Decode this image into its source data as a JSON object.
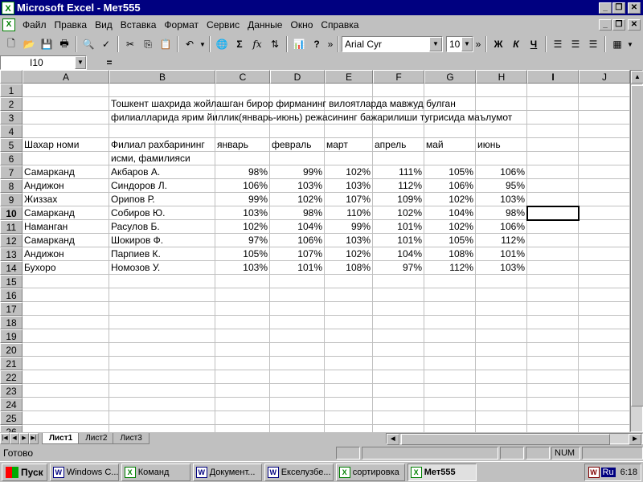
{
  "window": {
    "title": "Microsoft Excel - Мет555"
  },
  "menu": [
    "Файл",
    "Правка",
    "Вид",
    "Вставка",
    "Формат",
    "Сервис",
    "Данные",
    "Окно",
    "Справка"
  ],
  "toolbar": {
    "font_name": "Arial Cyr",
    "font_size": "10"
  },
  "formula_bar": {
    "name_box": "I10",
    "equals": "=",
    "formula": ""
  },
  "columns": [
    "A",
    "B",
    "C",
    "D",
    "E",
    "F",
    "G",
    "H",
    "I",
    "J"
  ],
  "rows": [
    "1",
    "2",
    "3",
    "4",
    "5",
    "6",
    "7",
    "8",
    "9",
    "10",
    "11",
    "12",
    "13",
    "14",
    "15",
    "16",
    "17",
    "18",
    "19",
    "20",
    "21",
    "22",
    "23",
    "24",
    "25",
    "26"
  ],
  "active_cell": {
    "row": 10,
    "col": "I"
  },
  "sheet": {
    "title_line1": "Тошкент шахрида жойлашган бирор фирманинг вилоятларда мавжуд булган",
    "title_line2": "филиалларида ярим йиллик(январь-июнь) режасининг бажарилиши тугрисида маълумот",
    "headers": {
      "city": "Шахар номи",
      "manager1": "Филиал рахбарининг",
      "manager2": "исми, фамилияси",
      "months": [
        "январь",
        "февраль",
        "март",
        "апрель",
        "май",
        "июнь"
      ]
    },
    "data": [
      {
        "city": "Самарканд",
        "name": "Акбаров А.",
        "values": [
          "98%",
          "99%",
          "102%",
          "111%",
          "105%",
          "106%"
        ]
      },
      {
        "city": "Андижон",
        "name": "Синдоров Л.",
        "values": [
          "106%",
          "103%",
          "103%",
          "112%",
          "106%",
          "95%"
        ]
      },
      {
        "city": "Жиззах",
        "name": "Орипов Р.",
        "values": [
          "99%",
          "102%",
          "107%",
          "109%",
          "102%",
          "103%"
        ]
      },
      {
        "city": "Самарканд",
        "name": "Собиров Ю.",
        "values": [
          "103%",
          "98%",
          "110%",
          "102%",
          "104%",
          "98%"
        ]
      },
      {
        "city": "Наманган",
        "name": "Расулов Б.",
        "values": [
          "102%",
          "104%",
          "99%",
          "101%",
          "102%",
          "106%"
        ]
      },
      {
        "city": "Самарканд",
        "name": "Шокиров Ф.",
        "values": [
          "97%",
          "106%",
          "103%",
          "101%",
          "105%",
          "112%"
        ]
      },
      {
        "city": "Андижон",
        "name": "Парпиев К.",
        "values": [
          "105%",
          "107%",
          "102%",
          "104%",
          "108%",
          "101%"
        ]
      },
      {
        "city": "Бухоро",
        "name": "Номозов У.",
        "values": [
          "103%",
          "101%",
          "108%",
          "97%",
          "112%",
          "103%"
        ]
      }
    ]
  },
  "sheet_tabs": [
    "Лист1",
    "Лист2",
    "Лист3"
  ],
  "status": {
    "text": "Готово",
    "num": "NUM"
  },
  "taskbar": {
    "start": "Пуск",
    "tasks": [
      "Windows C...",
      "Команд",
      "Документ...",
      "Екселузбе...",
      "сортировка",
      "Мет555"
    ],
    "lang": "Ru",
    "clock": "6:18"
  }
}
